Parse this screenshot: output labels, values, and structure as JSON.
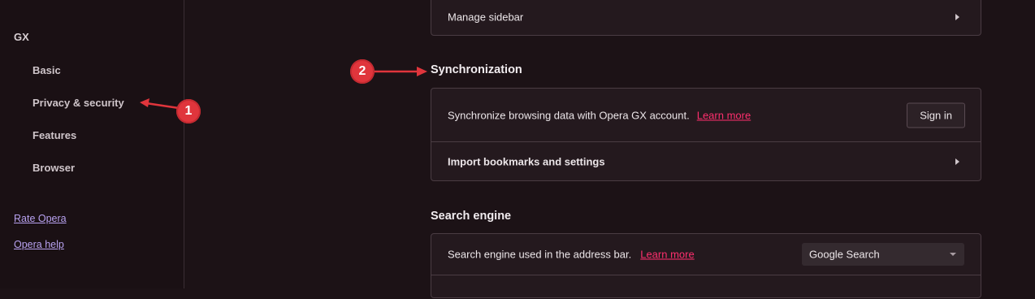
{
  "sidebar": {
    "section_title": "GX",
    "items": [
      {
        "label": "Basic"
      },
      {
        "label": "Privacy & security"
      },
      {
        "label": "Features"
      },
      {
        "label": "Browser"
      }
    ],
    "links": [
      {
        "label": "Rate Opera"
      },
      {
        "label": "Opera help"
      }
    ]
  },
  "top_card": {
    "manage_sidebar_label": "Manage sidebar"
  },
  "sync": {
    "title": "Synchronization",
    "description": "Synchronize browsing data with Opera GX account.",
    "learn_more": "Learn more",
    "sign_in_label": "Sign in",
    "import_label": "Import bookmarks and settings"
  },
  "search_engine": {
    "title": "Search engine",
    "description": "Search engine used in the address bar.",
    "learn_more": "Learn more",
    "selected": "Google Search"
  },
  "annotations": [
    {
      "number": "1"
    },
    {
      "number": "2"
    }
  ],
  "colors": {
    "annotation_red": "#e0353c",
    "link_pink": "#ff2f6e",
    "link_purple": "#b8a2f0"
  }
}
